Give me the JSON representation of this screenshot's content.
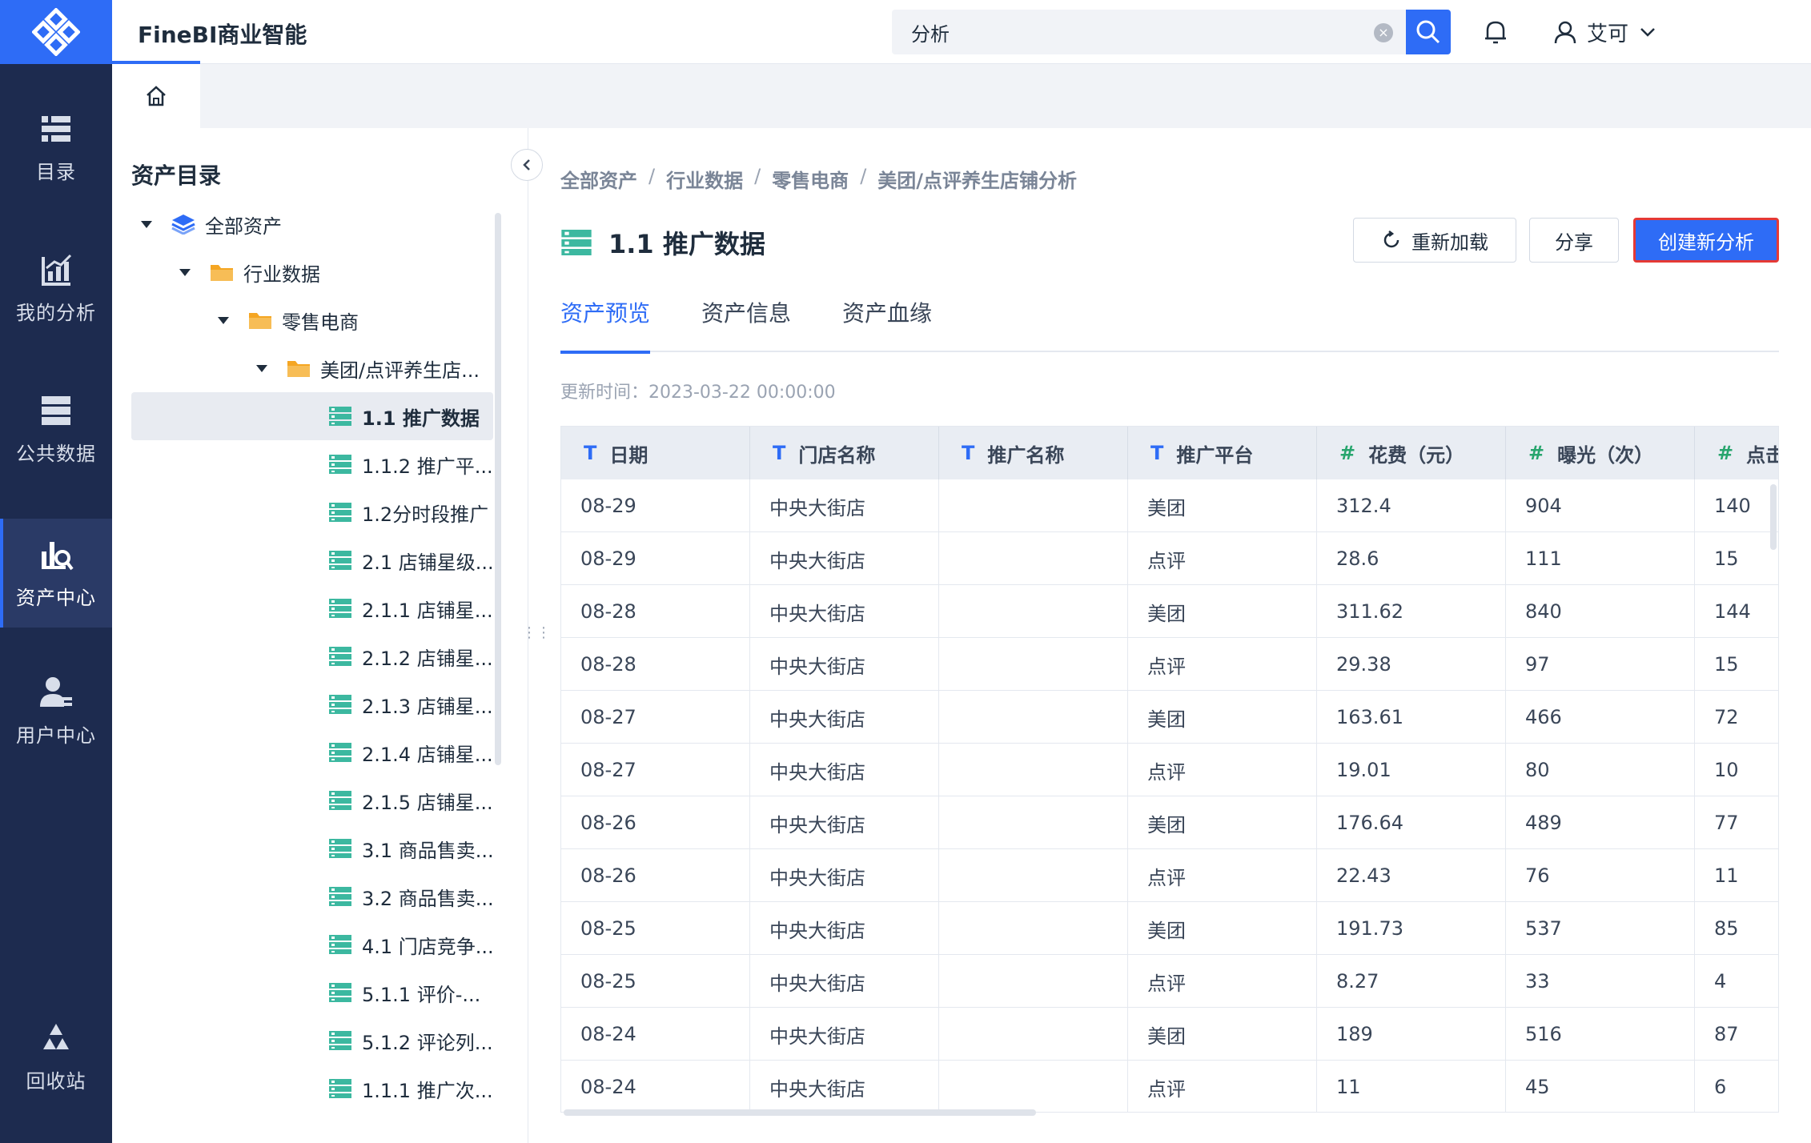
{
  "app": {
    "title": "FineBI商业智能"
  },
  "nav": {
    "items": [
      {
        "label": "目录"
      },
      {
        "label": "我的分析"
      },
      {
        "label": "公共数据"
      },
      {
        "label": "资产中心"
      },
      {
        "label": "用户中心"
      },
      {
        "label": "回收站"
      }
    ]
  },
  "search": {
    "value": "分析"
  },
  "user": {
    "name": "艾可"
  },
  "tree": {
    "title": "资产目录",
    "items": [
      {
        "label": "全部资产"
      },
      {
        "label": "行业数据"
      },
      {
        "label": "零售电商"
      },
      {
        "label": "美团/点评养生店..."
      },
      {
        "label": "1.1 推广数据"
      },
      {
        "label": "1.1.2 推广平..."
      },
      {
        "label": "1.2分时段推广"
      },
      {
        "label": "2.1 店铺星级..."
      },
      {
        "label": "2.1.1 店铺星..."
      },
      {
        "label": "2.1.2 店铺星..."
      },
      {
        "label": "2.1.3 店铺星..."
      },
      {
        "label": "2.1.4 店铺星..."
      },
      {
        "label": "2.1.5 店铺星..."
      },
      {
        "label": "3.1 商品售卖..."
      },
      {
        "label": "3.2 商品售卖..."
      },
      {
        "label": "4.1 门店竞争..."
      },
      {
        "label": "5.1.1 评价-..."
      },
      {
        "label": "5.1.2 评论列..."
      },
      {
        "label": "1.1.1 推广次..."
      }
    ]
  },
  "breadcrumb": [
    "全部资产",
    "行业数据",
    "零售电商",
    "美团/点评养生店铺分析"
  ],
  "breadcrumb_sep": "/",
  "page": {
    "title": "1.1 推广数据"
  },
  "buttons": {
    "reload": "重新加载",
    "share": "分享",
    "create": "创建新分析"
  },
  "tabs": [
    "资产预览",
    "资产信息",
    "资产血缘"
  ],
  "update_time": "更新时间：2023-03-22 00:00:00",
  "table": {
    "columns": [
      {
        "type": "T",
        "label": "日期"
      },
      {
        "type": "T",
        "label": "门店名称"
      },
      {
        "type": "T",
        "label": "推广名称"
      },
      {
        "type": "T",
        "label": "推广平台"
      },
      {
        "type": "#",
        "label": "花费（元）"
      },
      {
        "type": "#",
        "label": "曝光（次）"
      },
      {
        "type": "#",
        "label": "点击"
      }
    ],
    "rows": [
      [
        "08-29",
        "中央大街店",
        "",
        "美团",
        "312.4",
        "904",
        "140"
      ],
      [
        "08-29",
        "中央大街店",
        "",
        "点评",
        "28.6",
        "111",
        "15"
      ],
      [
        "08-28",
        "中央大街店",
        "",
        "美团",
        "311.62",
        "840",
        "144"
      ],
      [
        "08-28",
        "中央大街店",
        "",
        "点评",
        "29.38",
        "97",
        "15"
      ],
      [
        "08-27",
        "中央大街店",
        "",
        "美团",
        "163.61",
        "466",
        "72"
      ],
      [
        "08-27",
        "中央大街店",
        "",
        "点评",
        "19.01",
        "80",
        "10"
      ],
      [
        "08-26",
        "中央大街店",
        "",
        "美团",
        "176.64",
        "489",
        "77"
      ],
      [
        "08-26",
        "中央大街店",
        "",
        "点评",
        "22.43",
        "76",
        "11"
      ],
      [
        "08-25",
        "中央大街店",
        "",
        "美团",
        "191.73",
        "537",
        "85"
      ],
      [
        "08-25",
        "中央大街店",
        "",
        "点评",
        "8.27",
        "33",
        "4"
      ],
      [
        "08-24",
        "中央大街店",
        "",
        "美团",
        "189",
        "516",
        "87"
      ],
      [
        "08-24",
        "中央大街店",
        "",
        "点评",
        "11",
        "45",
        "6"
      ]
    ]
  },
  "colors": {
    "accent": "#2e6cf6",
    "rail": "#1d2b4f",
    "highlight": "#e53935",
    "numeric": "#27a56d"
  }
}
